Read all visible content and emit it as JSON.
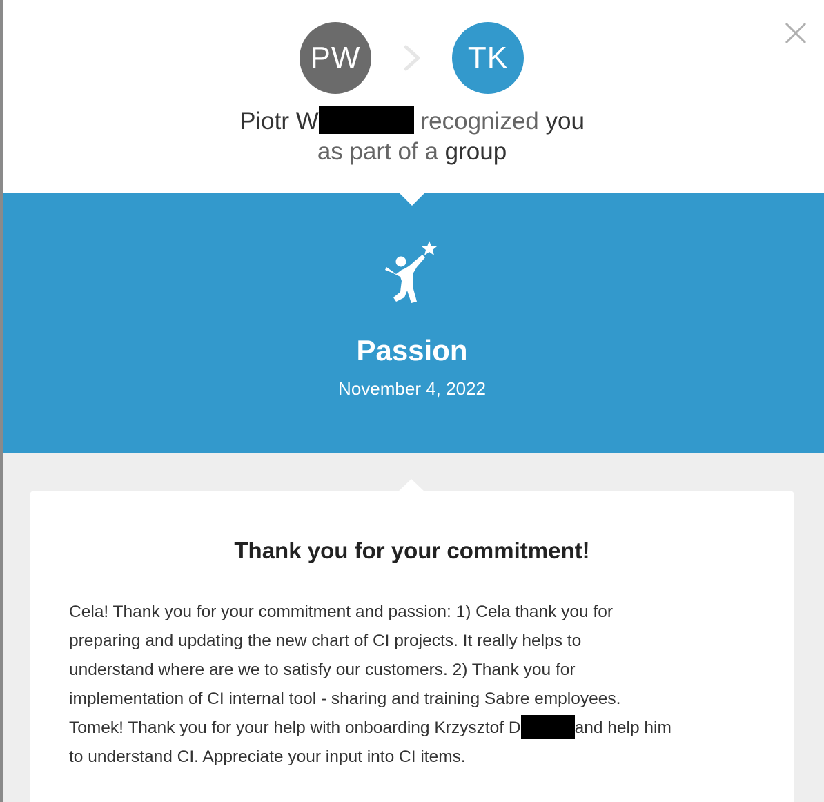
{
  "header": {
    "sender_initials": "PW",
    "recipient_initials": "TK",
    "sender_name": "Piotr W",
    "recognized_word": "recognized",
    "you_word": "you",
    "as_part_of_a": "as part of a",
    "group_word": "group"
  },
  "value": {
    "title": "Passion",
    "date": "November 4, 2022"
  },
  "message": {
    "title": "Thank you for your commitment!",
    "lines": [
      "Cela! Thank you for your commitment and passion: 1) Cela thank you for",
      "preparing and updating the new chart of CI projects. It really helps to",
      "understand where are we to satisfy our customers. 2) Thank you for",
      "implementation of CI internal tool - sharing and training Sabre employees."
    ],
    "line5_before": "Tomek! Thank you for your help with onboarding Krzysztof D",
    "line5_after": "and help him",
    "line6": "to understand CI. Appreciate your input into CI items."
  },
  "icons": {
    "close": "close-icon",
    "arrow": "chevron-right-icon",
    "value": "star-reach-figure-icon"
  },
  "colors": {
    "accent": "#3399cc",
    "sender_avatar": "#6b6b6b",
    "background_gray": "#eeeeee"
  }
}
